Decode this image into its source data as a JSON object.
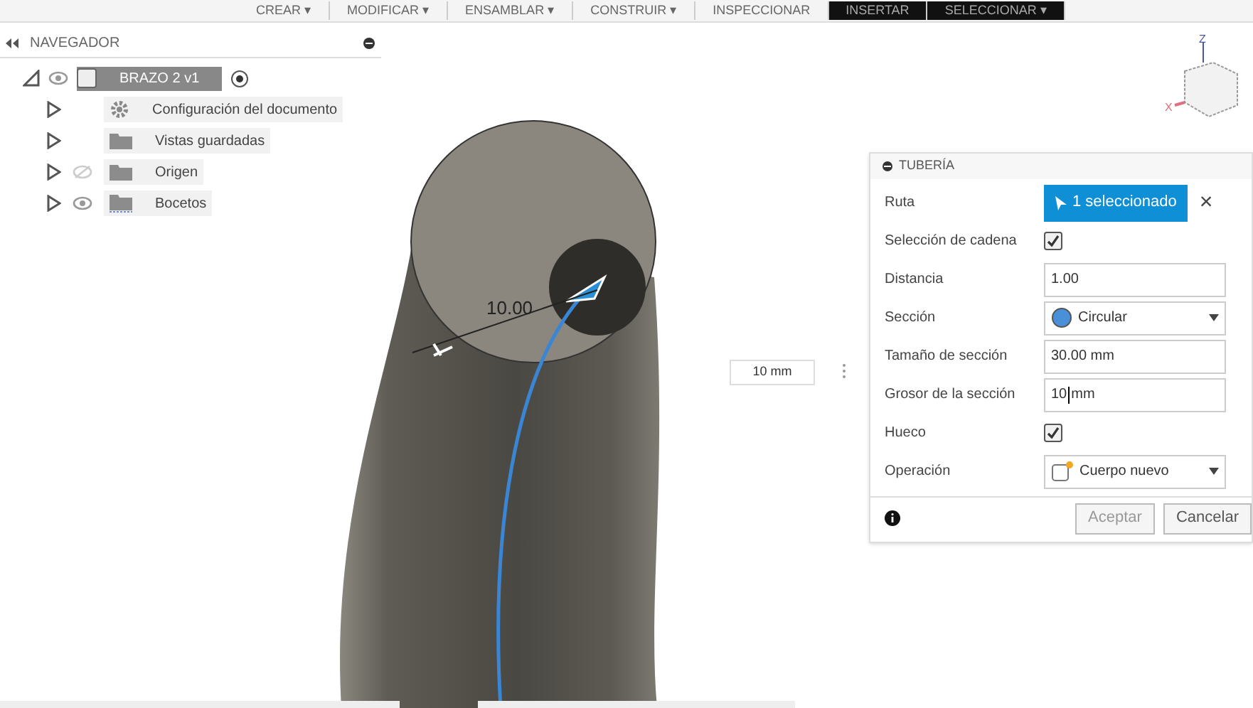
{
  "toolbar": {
    "menus": [
      {
        "label": "CREAR",
        "caret": "▾",
        "dimmed": false
      },
      {
        "label": "MODIFICAR",
        "caret": "▾",
        "dimmed": false
      },
      {
        "label": "ENSAMBLAR",
        "caret": "▾",
        "dimmed": false
      },
      {
        "label": "CONSTRUIR",
        "caret": "▾",
        "dimmed": false
      },
      {
        "label": "INSPECCIONAR",
        "dimmed": false
      },
      {
        "label": "INSERTAR",
        "dimmed": true
      },
      {
        "label": "SELECCIONAR",
        "caret": "▾",
        "dimmed": true
      }
    ]
  },
  "navigator": {
    "title": "NAVEGADOR",
    "root": {
      "label": "BRAZO 2 v1",
      "expanded": true,
      "visible": true,
      "children": [
        {
          "label": "Configuración del documento",
          "kind": "settings",
          "expanded": false
        },
        {
          "label": "Vistas guardadas",
          "kind": "views",
          "expanded": false
        },
        {
          "label": "Origen",
          "kind": "origin",
          "visible": false,
          "expanded": false
        },
        {
          "label": "Bocetos",
          "kind": "sketches",
          "visible": true,
          "expanded": false
        }
      ]
    }
  },
  "viewport": {
    "dimension": "10.00",
    "value_label": "10 mm",
    "viewcube": {
      "axis_z": "Z",
      "axis_x": "X"
    }
  },
  "dialog": {
    "title": "TUBERÍA",
    "rows": [
      {
        "kind": "selection",
        "label": "Ruta",
        "value": "1 seleccionado",
        "clear": "×"
      },
      {
        "kind": "checkbox",
        "label": "Selección de cadena",
        "checked": true
      },
      {
        "kind": "text",
        "label": "Distancia",
        "value": "1.00"
      },
      {
        "kind": "dropdown",
        "label": "Sección",
        "value": "Circular"
      },
      {
        "kind": "text",
        "label": "Tamaño de sección",
        "value": "30.00 mm"
      },
      {
        "kind": "text",
        "label": "Grosor de la sección",
        "value": "10",
        "value_after_cursor": "mm"
      },
      {
        "kind": "checkbox",
        "label": "Hueco",
        "checked": true
      },
      {
        "kind": "dropdown",
        "label": "Operación",
        "value": "Cuerpo nuevo"
      }
    ],
    "buttons": [
      "Aceptar",
      "Cancelar"
    ]
  }
}
